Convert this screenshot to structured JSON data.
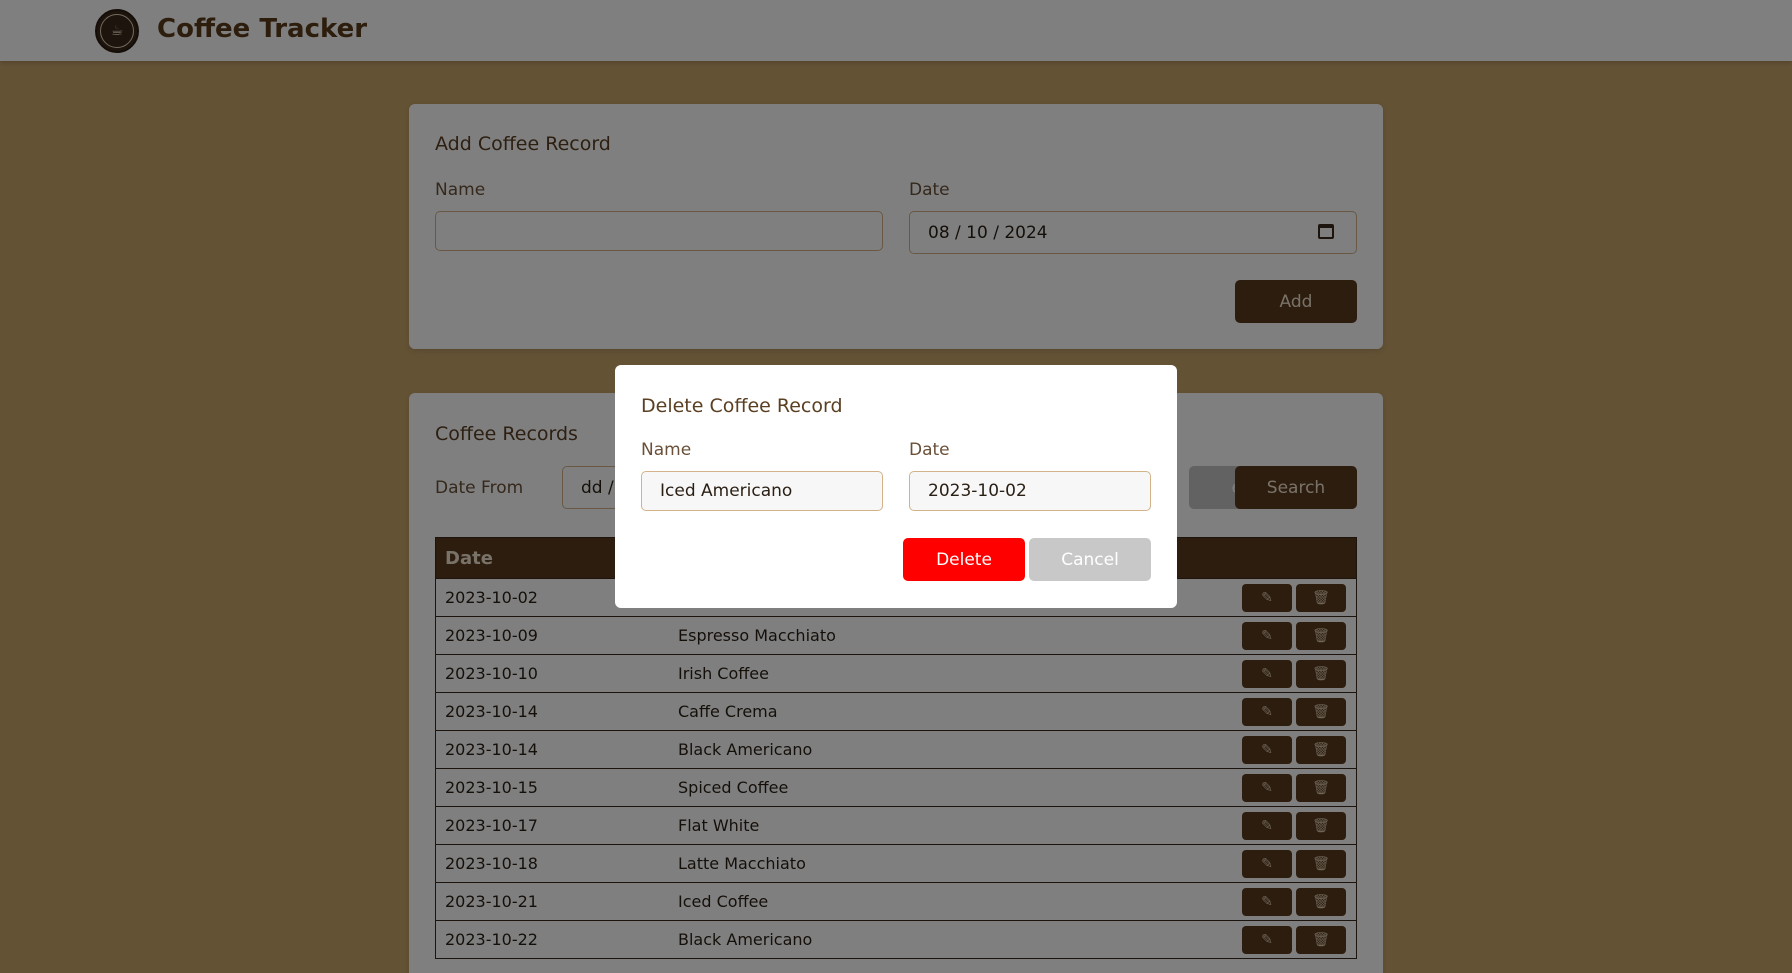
{
  "app": {
    "title": "Coffee Tracker"
  },
  "add_form": {
    "title": "Add Coffee Record",
    "name_label": "Name",
    "name_value": "",
    "date_label": "Date",
    "date_value": "08 / 10 / 2024",
    "add_label": "Add"
  },
  "records": {
    "title": "Coffee Records",
    "date_from_label": "Date From",
    "date_from_value": "dd /",
    "reset_label": "et",
    "search_label": "Search",
    "column_date": "Date",
    "rows": [
      {
        "date": "2023-10-02",
        "name": ""
      },
      {
        "date": "2023-10-09",
        "name": "Espresso Macchiato"
      },
      {
        "date": "2023-10-10",
        "name": "Irish Coffee"
      },
      {
        "date": "2023-10-14",
        "name": "Caffe Crema"
      },
      {
        "date": "2023-10-14",
        "name": "Black Americano"
      },
      {
        "date": "2023-10-15",
        "name": "Spiced Coffee"
      },
      {
        "date": "2023-10-17",
        "name": "Flat White"
      },
      {
        "date": "2023-10-18",
        "name": "Latte Macchiato"
      },
      {
        "date": "2023-10-21",
        "name": "Iced Coffee"
      },
      {
        "date": "2023-10-22",
        "name": "Black Americano"
      }
    ]
  },
  "delete_modal": {
    "title": "Delete Coffee Record",
    "name_label": "Name",
    "name_value": "Iced Americano",
    "date_label": "Date",
    "date_value": "2023-10-02",
    "delete_label": "Delete",
    "cancel_label": "Cancel"
  },
  "icons": {
    "edit": "edit-icon",
    "delete": "trash-icon",
    "calendar": "calendar-icon",
    "logo": "coffee-logo-icon"
  },
  "colors": {
    "background": "#c8a46a",
    "brand_dark": "#5a3b1e",
    "danger": "#ff0000",
    "cancel": "#c8c8c8"
  }
}
